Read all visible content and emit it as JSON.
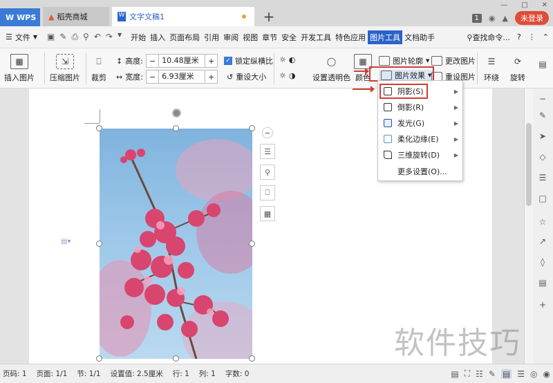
{
  "tabs": [
    {
      "label": "WPS"
    },
    {
      "label": "稻壳商城"
    },
    {
      "label": "文字文稿1",
      "modified": true
    }
  ],
  "topright": {
    "badge": "1",
    "login": "未登录"
  },
  "menu": {
    "file_label": "文件",
    "items": [
      "开始",
      "插入",
      "页面布局",
      "引用",
      "审阅",
      "视图",
      "章节",
      "安全",
      "开发工具",
      "特色应用",
      "图片工具",
      "文档助手"
    ],
    "active": "图片工具",
    "search": "查找命令..."
  },
  "ribbon": {
    "insert_picture": "插入图片",
    "compress": "压缩图片",
    "crop": "裁剪",
    "height_label": "高度:",
    "height_value": "10.48厘米",
    "width_label": "宽度:",
    "width_value": "6.93厘米",
    "lock_ratio": "锁定纵横比",
    "reset_size": "重设大小",
    "set_transparent": "设置透明色",
    "color": "颜色",
    "outline": "图片轮廓",
    "change_picture": "更改图片",
    "effects": "图片效果",
    "reset_picture": "重设图片",
    "wrap": "环绕",
    "rotate": "旋转"
  },
  "dropdown": {
    "items": [
      "阴影(S)",
      "倒影(R)",
      "发光(G)",
      "柔化边缘(E)",
      "三维旋转(D)",
      "更多设置(O)..."
    ]
  },
  "statusbar": {
    "page_num": "页码: 1",
    "pages": "页面: 1/1",
    "section": "节: 1/1",
    "setting": "设置值: 2.5厘米",
    "row": "行: 1",
    "col": "列: 1",
    "wordcount": "字数: 0"
  },
  "watermark": "软件技巧",
  "colors": {
    "accent": "#2a64c8",
    "highlight": "#d23a34",
    "wps_blue": "#3a7bd5"
  }
}
